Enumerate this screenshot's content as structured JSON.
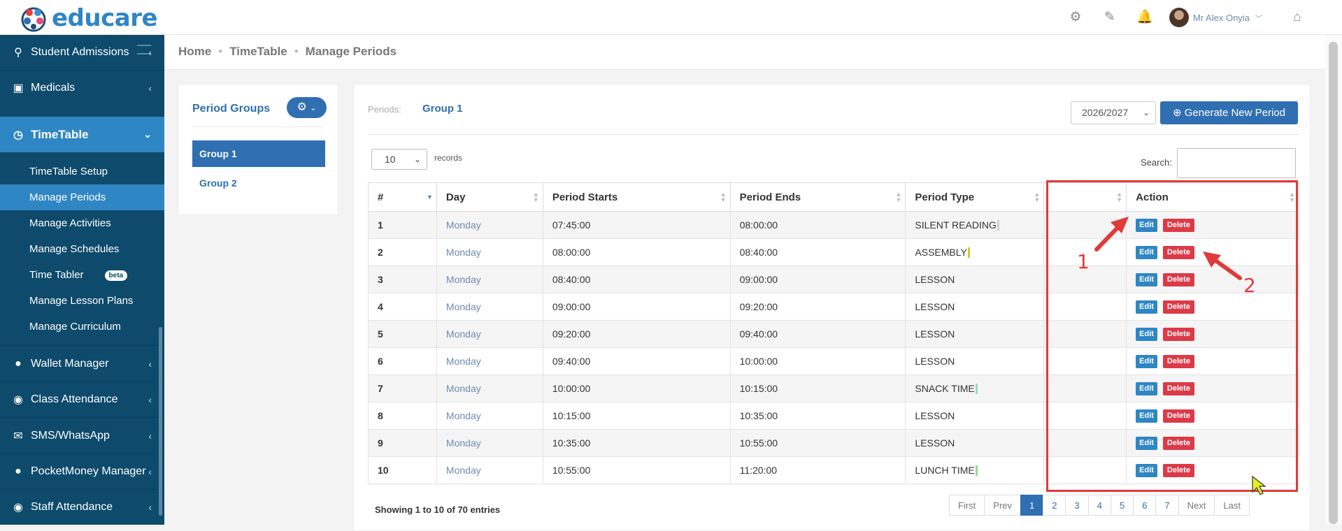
{
  "app": {
    "logo_text": "educare"
  },
  "topbar": {
    "user_name": "Mr Alex Onyia"
  },
  "sidebar": {
    "items": [
      {
        "label": "Student Admissions",
        "icon": "user-search-icon"
      },
      {
        "label": "Medicals",
        "icon": "first-aid-icon"
      },
      {
        "label": "TimeTable",
        "icon": "clock-icon"
      },
      {
        "label": "Wallet Manager",
        "icon": "piggy-bank-icon"
      },
      {
        "label": "Class Attendance",
        "icon": "eye-icon"
      },
      {
        "label": "SMS/WhatsApp",
        "icon": "envelope-icon"
      },
      {
        "label": "PocketMoney Manager",
        "icon": "piggy-bank-icon"
      },
      {
        "label": "Staff Attendance",
        "icon": "eye-icon"
      }
    ],
    "sub_items": [
      {
        "label": "TimeTable Setup"
      },
      {
        "label": "Manage Periods"
      },
      {
        "label": "Manage Activities"
      },
      {
        "label": "Manage Schedules"
      },
      {
        "label": "Time Tabler"
      },
      {
        "label": "Manage Lesson Plans"
      },
      {
        "label": "Manage Curriculum"
      }
    ],
    "beta_badge": "beta"
  },
  "breadcrumb": [
    "Home",
    "TimeTable",
    "Manage Periods"
  ],
  "period_groups": {
    "title": "Period Groups",
    "groups": [
      "Group 1",
      "Group 2"
    ]
  },
  "main": {
    "periods_label": "Periods:",
    "current_group": "Group 1",
    "year": "2026/2027",
    "generate_button": "Generate New Period",
    "page_length": "10",
    "records_label": "records",
    "search_label": "Search:",
    "search_value": "",
    "columns": [
      "#",
      "Day",
      "Period Starts",
      "Period Ends",
      "Period Type",
      "",
      "Action"
    ],
    "rows": [
      {
        "num": "1",
        "day": "Monday",
        "start": "07:45:00",
        "end": "08:00:00",
        "type": "SILENT READING",
        "color": "#cfcfcf"
      },
      {
        "num": "2",
        "day": "Monday",
        "start": "08:00:00",
        "end": "08:40:00",
        "type": "ASSEMBLY",
        "color": "#e3c21a"
      },
      {
        "num": "3",
        "day": "Monday",
        "start": "08:40:00",
        "end": "09:00:00",
        "type": "LESSON",
        "color": ""
      },
      {
        "num": "4",
        "day": "Monday",
        "start": "09:00:00",
        "end": "09:20:00",
        "type": "LESSON",
        "color": ""
      },
      {
        "num": "5",
        "day": "Monday",
        "start": "09:20:00",
        "end": "09:40:00",
        "type": "LESSON",
        "color": ""
      },
      {
        "num": "6",
        "day": "Monday",
        "start": "09:40:00",
        "end": "10:00:00",
        "type": "LESSON",
        "color": ""
      },
      {
        "num": "7",
        "day": "Monday",
        "start": "10:00:00",
        "end": "10:15:00",
        "type": "SNACK TIME",
        "color": "#9adfb8"
      },
      {
        "num": "8",
        "day": "Monday",
        "start": "10:15:00",
        "end": "10:35:00",
        "type": "LESSON",
        "color": ""
      },
      {
        "num": "9",
        "day": "Monday",
        "start": "10:35:00",
        "end": "10:55:00",
        "type": "LESSON",
        "color": ""
      },
      {
        "num": "10",
        "day": "Monday",
        "start": "10:55:00",
        "end": "11:20:00",
        "type": "LUNCH TIME",
        "color": "#8fdc8f"
      }
    ],
    "edit_label": "Edit",
    "delete_label": "Delete",
    "info": "Showing 1 to 10 of 70 entries",
    "pagination": [
      "First",
      "Prev",
      "1",
      "2",
      "3",
      "4",
      "5",
      "6",
      "7",
      "Next",
      "Last"
    ],
    "current_page": "1"
  },
  "annotations": {
    "label_1": "1",
    "label_2": "2",
    "color": "#e03a3a"
  }
}
